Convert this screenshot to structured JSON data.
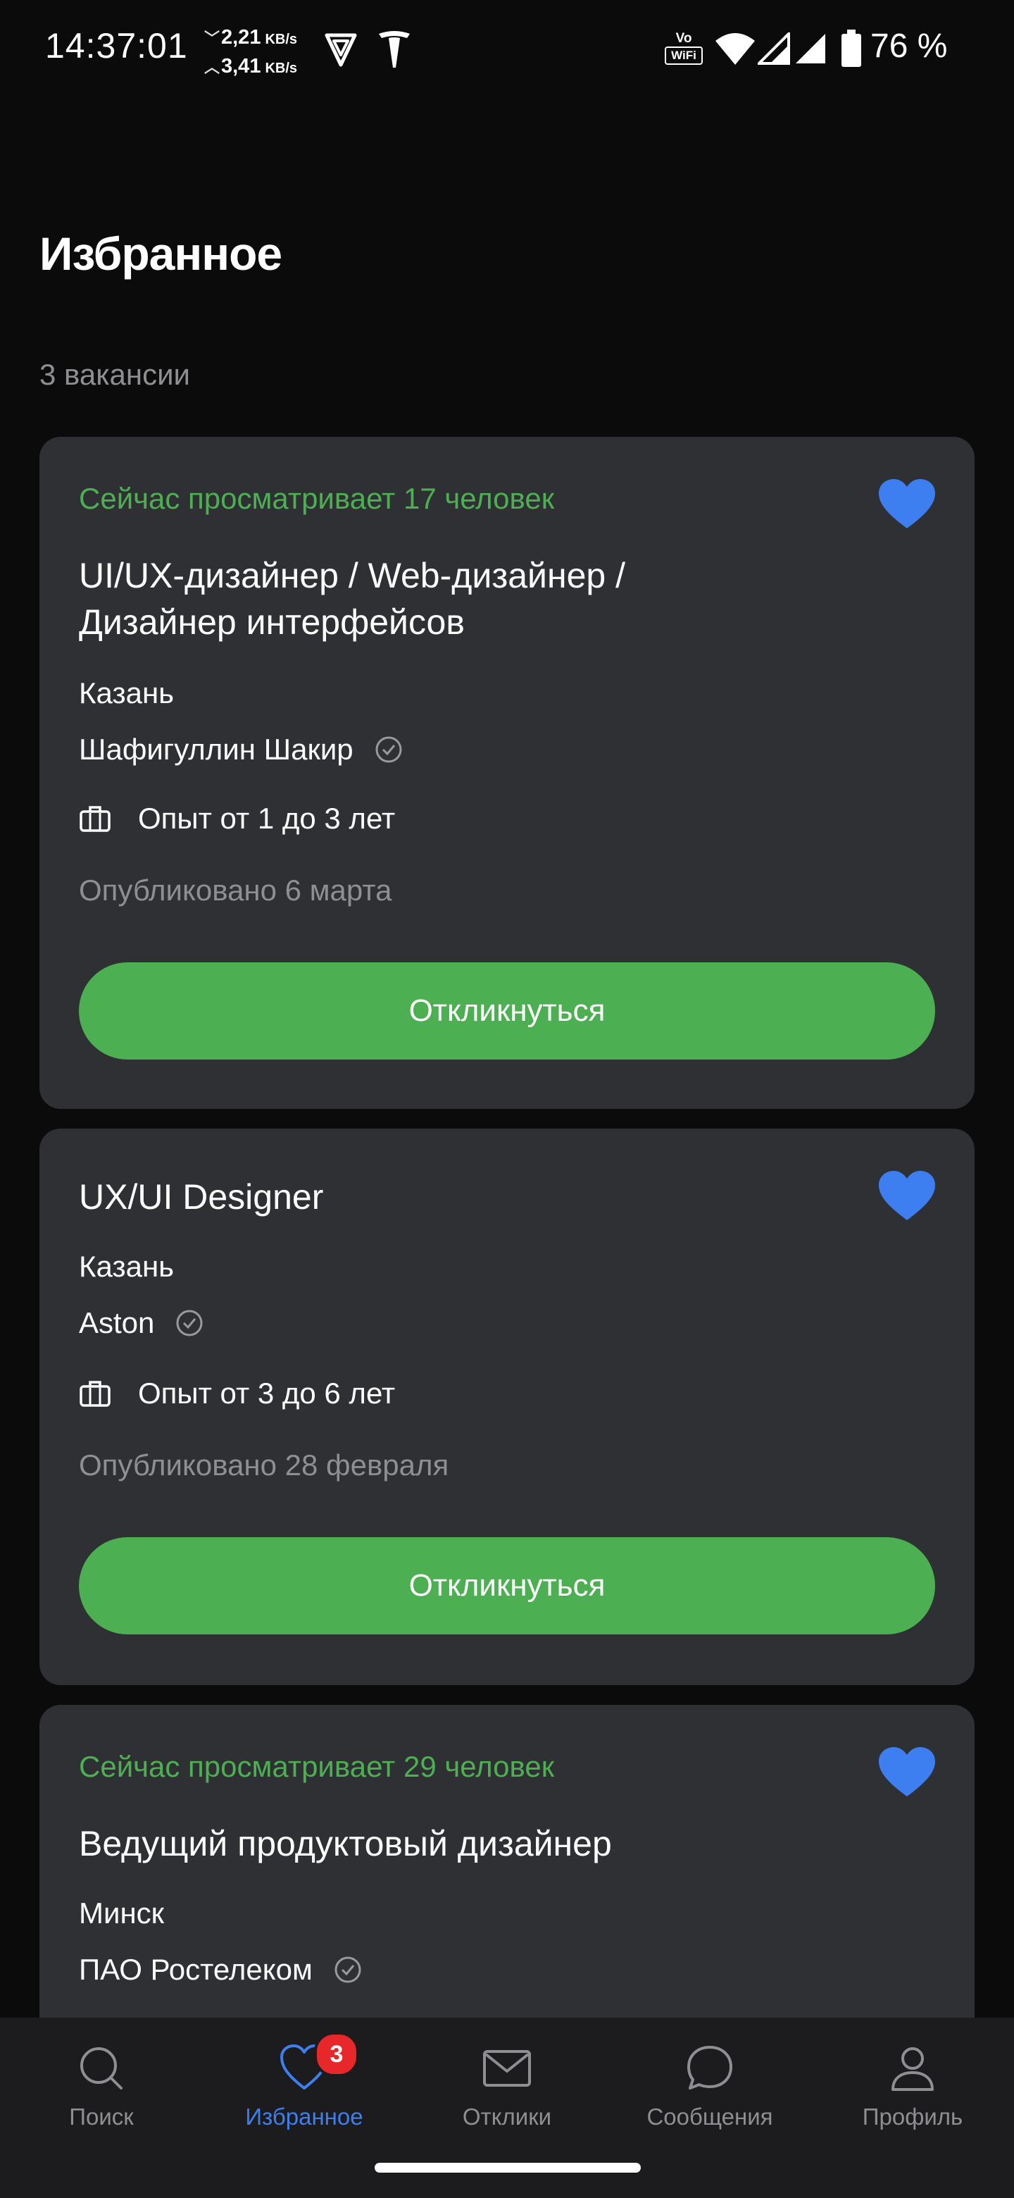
{
  "status_bar": {
    "time": "14:37:01",
    "download": "2,21",
    "upload": "3,41",
    "speed_unit": "KB/s",
    "battery": "76 %",
    "vowifi_top": "Vo",
    "vowifi_bottom": "WiFi"
  },
  "page": {
    "title": "Избранное",
    "count": "3 вакансии"
  },
  "vacancies": [
    {
      "viewers": "Сейчас просматривает 17 человек",
      "title": "UI/UX-дизайнер / Web-дизайнер / Дизайнер интерфейсов",
      "city": "Казань",
      "company": "Шафигуллин Шакир",
      "experience": "Опыт от 1 до 3 лет",
      "published": "Опубликовано 6 марта",
      "button": "Откликнуться"
    },
    {
      "title": "UX/UI Designer",
      "city": "Казань",
      "company": "Aston",
      "experience": "Опыт от 3 до 6 лет",
      "published": "Опубликовано 28 февраля",
      "button": "Откликнуться"
    },
    {
      "viewers": "Сейчас просматривает 29 человек",
      "title": "Ведущий продуктовый дизайнер",
      "city": "Минск",
      "company": "ПАО Ростелеком"
    }
  ],
  "nav": {
    "items": [
      {
        "label": "Поиск"
      },
      {
        "label": "Избранное",
        "badge": "3"
      },
      {
        "label": "Отклики"
      },
      {
        "label": "Сообщения"
      },
      {
        "label": "Профиль"
      }
    ]
  },
  "colors": {
    "background": "#0b0b0c",
    "card": "#2f3033",
    "accent_green": "#4cb052",
    "accent_blue": "#3d7ff0",
    "badge_red": "#e8272b"
  }
}
